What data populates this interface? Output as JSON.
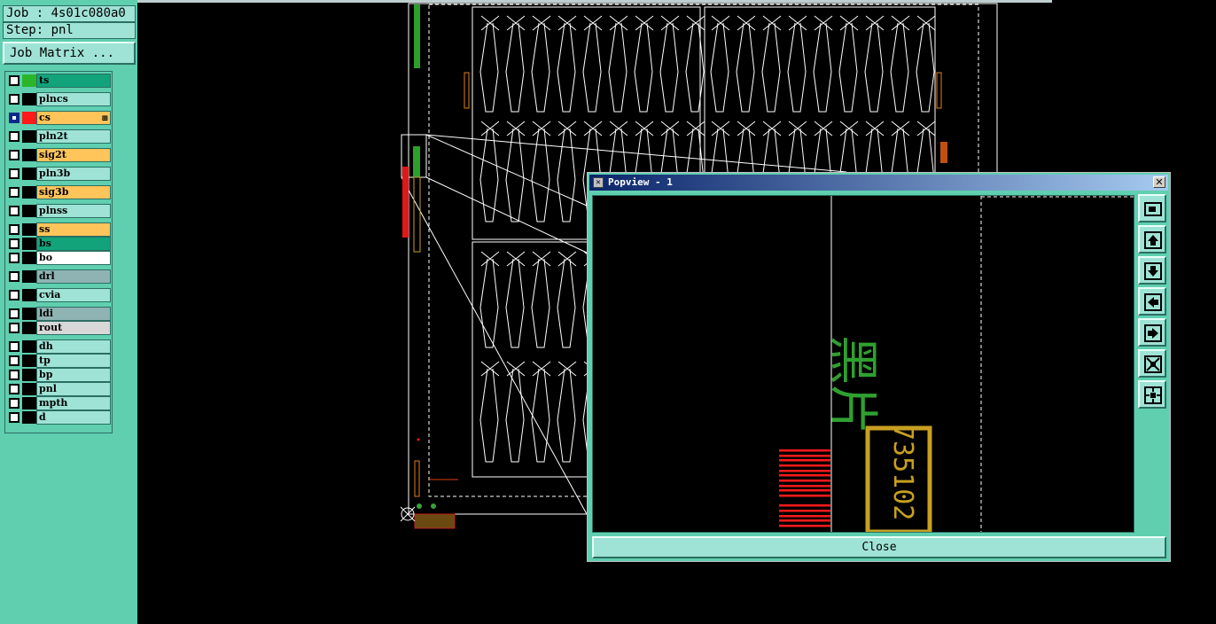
{
  "job_info": {
    "job_label": "Job : 4s01c080a0",
    "step_label": "Step: pnl"
  },
  "job_matrix_button": "Job Matrix ...",
  "layers": [
    {
      "name": "ts",
      "color": "#12a37a",
      "swatch": "#2bb52b",
      "active": false
    },
    {
      "name": "plncs",
      "color": "#9fe3d6",
      "swatch": null,
      "active": false
    },
    {
      "name": "cs",
      "color": "#ffc45a",
      "swatch": "#ff1a1a",
      "active": true,
      "extra": "⊞"
    },
    {
      "name": "pln2t",
      "color": "#9fe3d6",
      "swatch": null,
      "active": false
    },
    {
      "name": "sig2t",
      "color": "#ffc45a",
      "swatch": null,
      "active": false
    },
    {
      "name": "pln3b",
      "color": "#9fe3d6",
      "swatch": null,
      "active": false
    },
    {
      "name": "sig3b",
      "color": "#ffc45a",
      "swatch": null,
      "active": false
    },
    {
      "name": "plnss",
      "color": "#9fe3d6",
      "swatch": null,
      "active": false
    },
    {
      "name": "ss",
      "color": "#ffc45a",
      "swatch": null,
      "active": false
    },
    {
      "name": "bs",
      "color": "#12a37a",
      "swatch": null,
      "active": false
    },
    {
      "name": "bo",
      "color": "#ffffff",
      "swatch": null,
      "active": false
    },
    {
      "name": "drl",
      "color": "#8fb3b3",
      "swatch": null,
      "active": false
    },
    {
      "name": "cvia",
      "color": "#9fe3d6",
      "swatch": null,
      "active": false
    },
    {
      "name": "ldi",
      "color": "#8fb3b3",
      "swatch": null,
      "active": false
    },
    {
      "name": "rout",
      "color": "#d8d8d8",
      "swatch": null,
      "active": false
    },
    {
      "name": "dh",
      "color": "#9fe3d6",
      "swatch": null,
      "active": false
    },
    {
      "name": "tp",
      "color": "#9fe3d6",
      "swatch": null,
      "active": false
    },
    {
      "name": "bp",
      "color": "#9fe3d6",
      "swatch": null,
      "active": false
    },
    {
      "name": "pnl",
      "color": "#9fe3d6",
      "swatch": null,
      "active": false
    },
    {
      "name": "mpth",
      "color": "#9fe3d6",
      "swatch": null,
      "active": false
    },
    {
      "name": "d",
      "color": "#9fe3d6",
      "swatch": null,
      "active": false
    }
  ],
  "popview": {
    "title": "Popview - 1",
    "close_label": "Close",
    "view_text_chinese": "黑片",
    "view_text_number": "735102",
    "tools": [
      "zoom-window-icon",
      "pan-up-icon",
      "pan-down-icon",
      "pan-left-icon",
      "pan-right-icon",
      "zoom-in-icon",
      "zoom-out-icon"
    ]
  },
  "colors": {
    "panel": "#5fcfb0",
    "field": "#9fe3d6",
    "outline": "#ffffff",
    "green_text": "#2fa02f",
    "gold": "#c8a020",
    "red": "#ff1a1a"
  }
}
